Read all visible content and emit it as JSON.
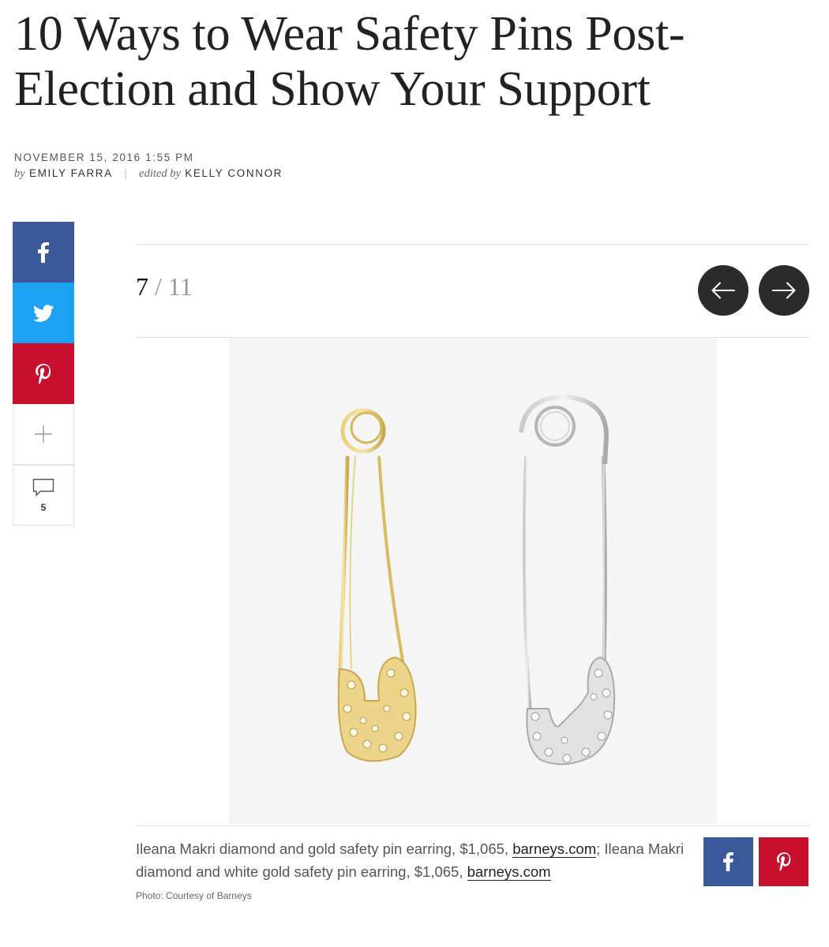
{
  "article": {
    "title": "10 Ways to Wear Safety Pins Post-Election and Show Your Support",
    "date": "November 15, 2016",
    "time": "1:55 PM",
    "by_label": "by",
    "author": "Emily Farra",
    "edited_label": "edited by",
    "editor": "Kelly Connor"
  },
  "share_rail": {
    "comment_count": "5"
  },
  "slideshow": {
    "current": "7",
    "separator": "/",
    "total": "11"
  },
  "caption": {
    "part1": "Ileana Makri diamond and gold safety pin earring, $1,065, ",
    "link1": "barneys.com",
    "part2": "; Ileana Makri diamond and white gold safety pin earring, $1,065, ",
    "link2": "barneys.com",
    "credit": "Photo: Courtesy of Barneys"
  },
  "colors": {
    "facebook": "#3b5998",
    "twitter": "#1da1f2",
    "pinterest": "#c8102e",
    "nav_button": "#2b2b2b"
  },
  "icons": [
    "facebook-icon",
    "twitter-icon",
    "pinterest-icon",
    "plus-icon",
    "comment-icon",
    "arrow-left-icon",
    "arrow-right-icon"
  ]
}
